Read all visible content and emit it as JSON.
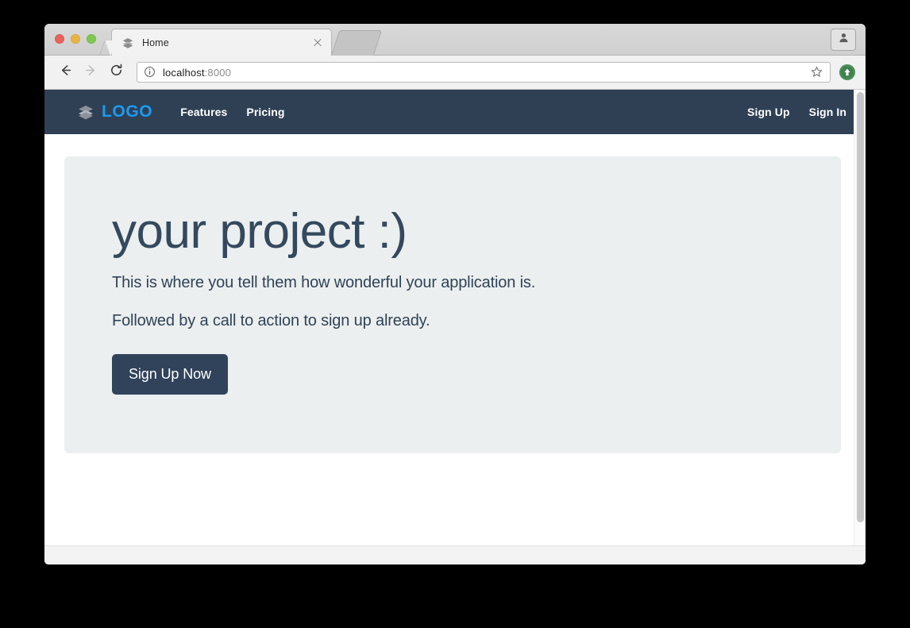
{
  "browser": {
    "window_controls": [
      {
        "name": "close",
        "color": "#e9615b"
      },
      {
        "name": "minimize",
        "color": "#e9b342"
      },
      {
        "name": "zoom",
        "color": "#7ec850"
      }
    ],
    "tab": {
      "title": "Home",
      "favicon": "layers-icon",
      "close_label": "×"
    },
    "new_tab_label": "+",
    "profile_icon": "person-icon",
    "toolbar": {
      "back_label": "Back",
      "forward_label": "Forward",
      "reload_label": "Reload",
      "security_icon": "info-circle-icon",
      "url_host": "localhost",
      "url_port": ":8000",
      "url_full": "localhost:8000",
      "bookmark_icon": "star-icon",
      "extension_icon": "green-up-arrow-icon"
    }
  },
  "site": {
    "navbar": {
      "brand": {
        "icon": "layers-icon",
        "text": "LOGO",
        "color": "#1b9bf0"
      },
      "background": "#2f4055",
      "links_left": [
        {
          "label": "Features"
        },
        {
          "label": "Pricing"
        }
      ],
      "links_right": [
        {
          "label": "Sign Up"
        },
        {
          "label": "Sign In"
        }
      ]
    },
    "hero": {
      "background": "#ecefef",
      "title": "your project :)",
      "lead_1": "This is where you tell them how wonderful your application is.",
      "lead_2": "Followed by a call to action to sign up already.",
      "cta_label": "Sign Up Now",
      "cta_color": "#31435a"
    }
  }
}
